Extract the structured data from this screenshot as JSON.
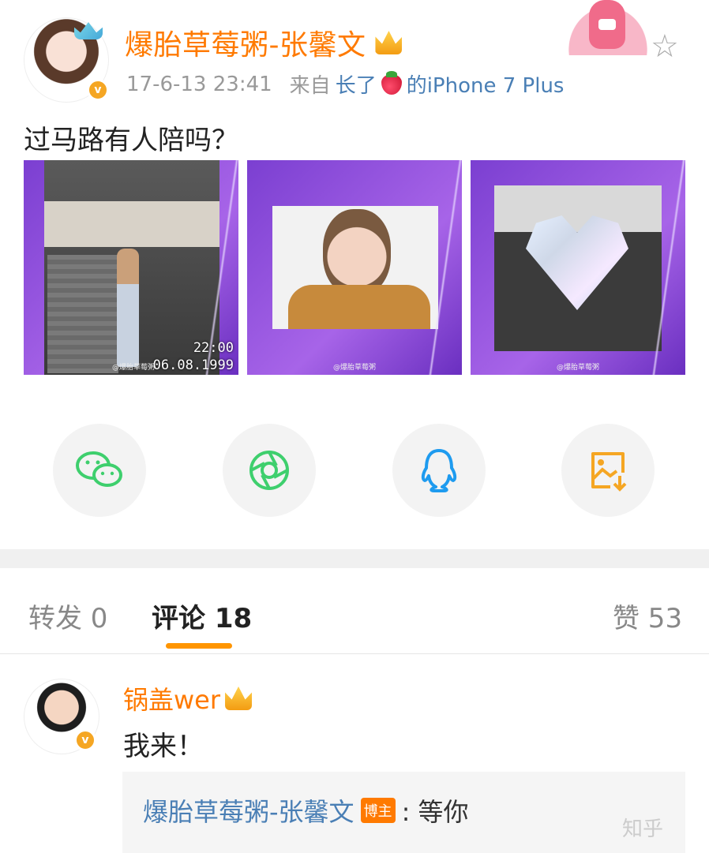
{
  "post": {
    "author": "爆胎草莓粥-张馨文",
    "timestamp": "17-6-13 23:41",
    "source_prefix": "来自",
    "source_name_a": "长了",
    "source_name_b": "的iPhone 7 Plus",
    "text": "过马路有人陪吗？",
    "images": [
      {
        "caption_time": "22:00",
        "caption_date": "06.08.1999",
        "watermark": "@爆胎草莓粥"
      },
      {
        "watermark": "@爆胎草莓粥"
      },
      {
        "watermark": "@爆胎草莓粥"
      }
    ]
  },
  "share": {
    "icons": [
      "wechat-icon",
      "moments-icon",
      "qq-icon",
      "save-image-icon"
    ]
  },
  "tabs": {
    "repost": "转发 0",
    "comment": "评论 18",
    "like": "赞 53"
  },
  "comment": {
    "author": "锅盖wer",
    "text": "我来！",
    "reply_author": "爆胎草莓粥-张馨文",
    "reply_tag": "博主",
    "reply_text": ": 等你"
  },
  "watermark_site": "知乎",
  "colors": {
    "accent": "#ff7a00",
    "link": "#4a7fb5",
    "wechat": "#3ecf6d",
    "qq": "#1e9bef",
    "save": "#f5a623"
  }
}
